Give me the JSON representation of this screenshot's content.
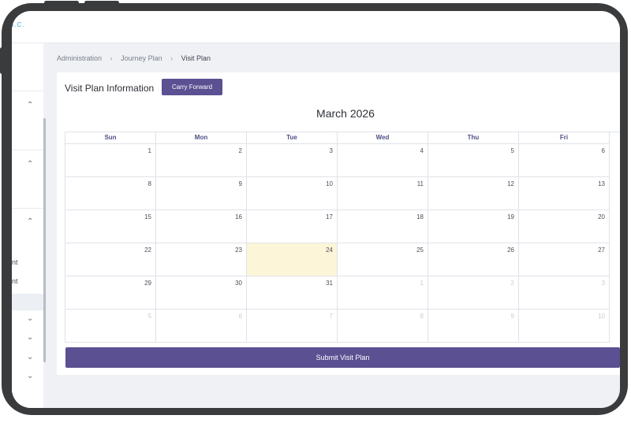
{
  "app": {
    "brand_fragment": "I.C."
  },
  "sidebar": {
    "items": [
      {
        "label": "",
        "chevron": "chevron-up-icon"
      },
      {
        "label": "",
        "chevron": "chevron-up-icon"
      },
      {
        "label": "",
        "chevron": "chevron-up-icon"
      },
      {
        "label": "nt"
      },
      {
        "label": "nt"
      },
      {
        "label": "",
        "chevron": "chevron-down-icon"
      },
      {
        "label": "",
        "chevron": "chevron-down-icon"
      },
      {
        "label": "",
        "chevron": "chevron-down-icon"
      },
      {
        "label": "",
        "chevron": "chevron-down-icon"
      }
    ]
  },
  "breadcrumb": {
    "items": [
      "Administration",
      "Journey Plan",
      "Visit Plan"
    ],
    "separator": "›"
  },
  "card": {
    "title": "Visit Plan Information",
    "carry_forward_label": "Carry Forward",
    "month_title": "March 2026",
    "submit_label": "Submit Visit Plan"
  },
  "calendar": {
    "weekdays": [
      "Sun",
      "Mon",
      "Tue",
      "Wed",
      "Thu",
      "Fri"
    ],
    "weeks": [
      [
        {
          "d": "1"
        },
        {
          "d": "2"
        },
        {
          "d": "3"
        },
        {
          "d": "4"
        },
        {
          "d": "5"
        },
        {
          "d": "6"
        }
      ],
      [
        {
          "d": "8"
        },
        {
          "d": "9"
        },
        {
          "d": "10"
        },
        {
          "d": "11"
        },
        {
          "d": "12"
        },
        {
          "d": "13"
        }
      ],
      [
        {
          "d": "15"
        },
        {
          "d": "16"
        },
        {
          "d": "17"
        },
        {
          "d": "18"
        },
        {
          "d": "19"
        },
        {
          "d": "20"
        }
      ],
      [
        {
          "d": "22"
        },
        {
          "d": "23"
        },
        {
          "d": "24",
          "today": true
        },
        {
          "d": "25"
        },
        {
          "d": "26"
        },
        {
          "d": "27"
        }
      ],
      [
        {
          "d": "29"
        },
        {
          "d": "30"
        },
        {
          "d": "31"
        },
        {
          "d": "1",
          "other": true
        },
        {
          "d": "2",
          "other": true
        },
        {
          "d": "3",
          "other": true
        }
      ],
      [
        {
          "d": "5",
          "other": true
        },
        {
          "d": "6",
          "other": true
        },
        {
          "d": "7",
          "other": true
        },
        {
          "d": "8",
          "other": true
        },
        {
          "d": "9",
          "other": true
        },
        {
          "d": "10",
          "other": true
        }
      ]
    ]
  },
  "colors": {
    "accent": "#5a5092",
    "weekday_text": "#4d4f86",
    "today_highlight": "#fdf5d8",
    "device_frame": "#3a3b3d"
  }
}
